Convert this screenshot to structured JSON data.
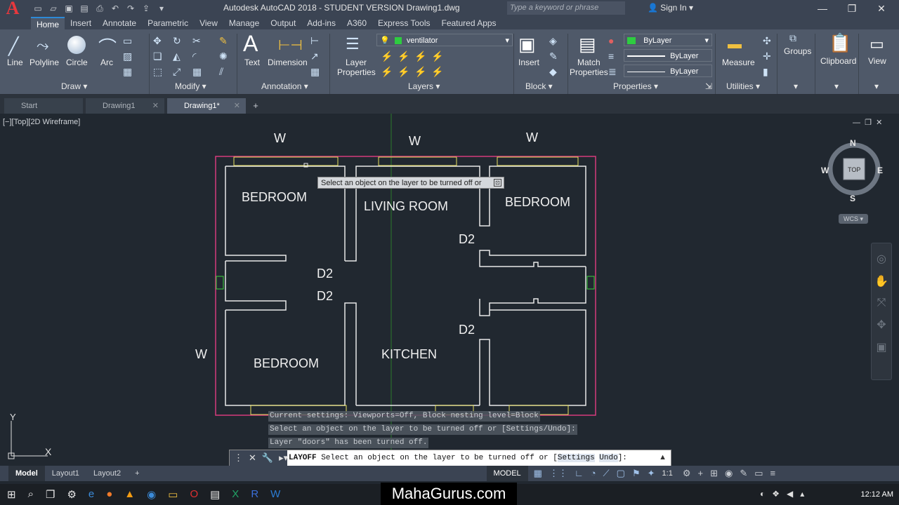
{
  "app": {
    "window_title": "Autodesk AutoCAD 2018 - STUDENT VERSION    Drawing1.dwg",
    "search_placeholder": "Type a keyword or phrase",
    "sign_in": "Sign In",
    "logo_letter": "A"
  },
  "ribbon_tabs": [
    "Home",
    "Insert",
    "Annotate",
    "Parametric",
    "View",
    "Manage",
    "Output",
    "Add-ins",
    "A360",
    "Express Tools",
    "Featured Apps"
  ],
  "ribbon": {
    "draw": {
      "line": "Line",
      "polyline": "Polyline",
      "circle": "Circle",
      "arc": "Arc",
      "panel": "Draw"
    },
    "modify": {
      "panel": "Modify"
    },
    "annotation": {
      "text": "Text",
      "dimension": "Dimension",
      "panel": "Annotation"
    },
    "layers": {
      "layer_properties_1": "Layer",
      "layer_properties_2": "Properties",
      "current_layer": "ventilator",
      "panel": "Layers"
    },
    "block": {
      "insert": "Insert",
      "panel": "Block"
    },
    "properties": {
      "match_1": "Match",
      "match_2": "Properties",
      "color": "ByLayer",
      "linetype": "ByLayer",
      "lineweight": "ByLayer",
      "panel": "Properties"
    },
    "utilities": {
      "measure": "Measure",
      "panel": "Utilities"
    },
    "groups": "Groups",
    "clipboard": "Clipboard",
    "view": "View"
  },
  "doc_tabs": [
    "Start",
    "Drawing1",
    "Drawing1*"
  ],
  "viewport_label": "[−][Top][2D Wireframe]",
  "plan_labels": {
    "bedroom_tl": "BEDROOM",
    "living": "LIVING ROOM",
    "bedroom_tr": "BEDROOM",
    "bedroom_bl": "BEDROOM",
    "kitchen": "KITCHEN",
    "w_top_left": "W",
    "w_top_mid": "W",
    "w_top_right": "W",
    "w_left": "W",
    "d2_a": "D2",
    "d2_b": "D2",
    "d2_c": "D2",
    "d2_d": "D2"
  },
  "tooltip": "Select an object on the layer to be turned off or",
  "command_history": [
    "Current settings: Viewports=Off, Block nesting level=Block",
    "Select an object on the layer to be turned off or [Settings/Undo]:",
    "Layer \"doors\" has been turned off."
  ],
  "command_line": {
    "command": "LAYOFF",
    "prompt": " Select an object on the layer to be turned off or [",
    "opt1": "Settings",
    "opt2": "Undo",
    "end": "]:"
  },
  "nav": {
    "n": "N",
    "s": "S",
    "e": "E",
    "w": "W",
    "top": "TOP",
    "wcs": "WCS"
  },
  "ucs": {
    "x": "X",
    "y": "Y"
  },
  "status": {
    "model_tab": "Model",
    "layout1": "Layout1",
    "layout2": "Layout2",
    "model_btn": "MODEL",
    "scale": "1:1"
  },
  "taskbar": {
    "brand": "MahaGurus.com",
    "time": "12:12 AM"
  }
}
